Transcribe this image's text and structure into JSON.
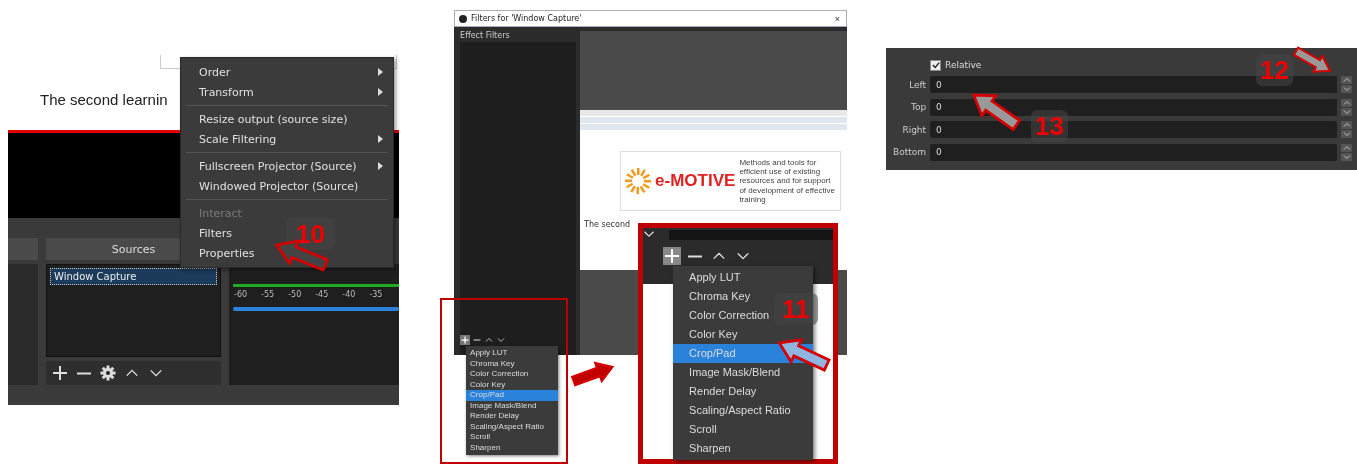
{
  "panel_1": {
    "document_text": "The second learnin",
    "dock_header": "Sources",
    "sources": [
      {
        "name": "Window Capture",
        "selected": true
      }
    ],
    "meter_ticks": [
      "-60",
      "-55",
      "-50",
      "-45",
      "-40",
      "-35"
    ],
    "volume": {
      "level": 1
    },
    "context_menu": {
      "groups": [
        [
          {
            "label": "Order",
            "submenu": true,
            "disabled": false
          },
          {
            "label": "Transform",
            "submenu": true,
            "disabled": false
          }
        ],
        [
          {
            "label": "Resize output (source size)",
            "submenu": false,
            "disabled": false
          },
          {
            "label": "Scale Filtering",
            "submenu": true,
            "disabled": false
          }
        ],
        [
          {
            "label": "Fullscreen Projector (Source)",
            "submenu": true,
            "disabled": false
          },
          {
            "label": "Windowed Projector (Source)",
            "submenu": false,
            "disabled": false
          }
        ],
        [
          {
            "label": "Interact",
            "submenu": false,
            "disabled": true
          },
          {
            "label": "Filters",
            "submenu": false,
            "disabled": false
          },
          {
            "label": "Properties",
            "submenu": false,
            "disabled": false
          }
        ]
      ]
    },
    "callout": "10"
  },
  "panel_2": {
    "dialog_title": "Filters for 'Window Capture'",
    "close": "×",
    "list_label": "Effect Filters",
    "document": {
      "logo": "e-MOTIVE",
      "tagline": "Methods and tools for efficient use of existing resources and for support of development of effective training",
      "body_text": "The second"
    },
    "filters": [
      {
        "label": "Apply LUT",
        "selected": false
      },
      {
        "label": "Chroma Key",
        "selected": false
      },
      {
        "label": "Color Correction",
        "selected": false
      },
      {
        "label": "Color Key",
        "selected": false
      },
      {
        "label": "Crop/Pad",
        "selected": true
      },
      {
        "label": "Image Mask/Blend",
        "selected": false
      },
      {
        "label": "Render Delay",
        "selected": false
      },
      {
        "label": "Scaling/Aspect Ratio",
        "selected": false
      },
      {
        "label": "Scroll",
        "selected": false
      },
      {
        "label": "Sharpen",
        "selected": false
      }
    ],
    "zoomed_filters": [
      {
        "label": "Apply LUT",
        "selected": false
      },
      {
        "label": "Chroma Key",
        "selected": false
      },
      {
        "label": "Color Correction",
        "selected": false
      },
      {
        "label": "Color Key",
        "selected": false
      },
      {
        "label": "Crop/Pad",
        "selected": true
      },
      {
        "label": "Image Mask/Blend",
        "selected": false
      },
      {
        "label": "Render Delay",
        "selected": false
      },
      {
        "label": "Scaling/Aspect Ratio",
        "selected": false
      },
      {
        "label": "Scroll",
        "selected": false
      },
      {
        "label": "Sharpen",
        "selected": false
      }
    ],
    "callout": "11"
  },
  "panel_3": {
    "relative": {
      "label": "Relative",
      "checked": true
    },
    "fields": [
      {
        "label": "Left",
        "value": "0"
      },
      {
        "label": "Top",
        "value": "0"
      },
      {
        "label": "Right",
        "value": "0"
      },
      {
        "label": "Bottom",
        "value": "0"
      }
    ],
    "callouts": [
      "12",
      "13"
    ]
  }
}
